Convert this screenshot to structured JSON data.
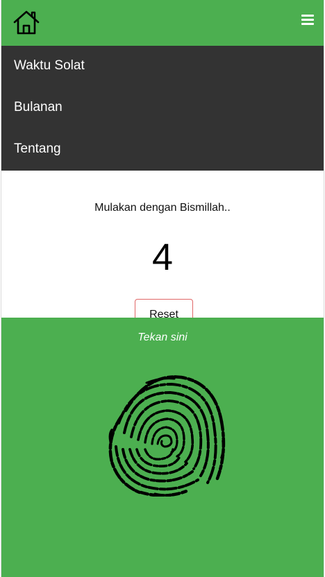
{
  "header": {
    "home_icon": "home-icon",
    "menu_icon": "hamburger-menu-icon",
    "background": "#4caf50"
  },
  "nav": {
    "items": [
      {
        "label": "Waktu Solat"
      },
      {
        "label": "Bulanan"
      },
      {
        "label": "Tentang"
      }
    ],
    "background": "#333333"
  },
  "main": {
    "intro_text": "Mulakan dengan Bismillah..",
    "counter_value": "4",
    "reset_label": "Reset"
  },
  "tap_zone": {
    "label": "Tekan sini",
    "icon": "fingerprint-icon",
    "background": "#4caf50"
  }
}
